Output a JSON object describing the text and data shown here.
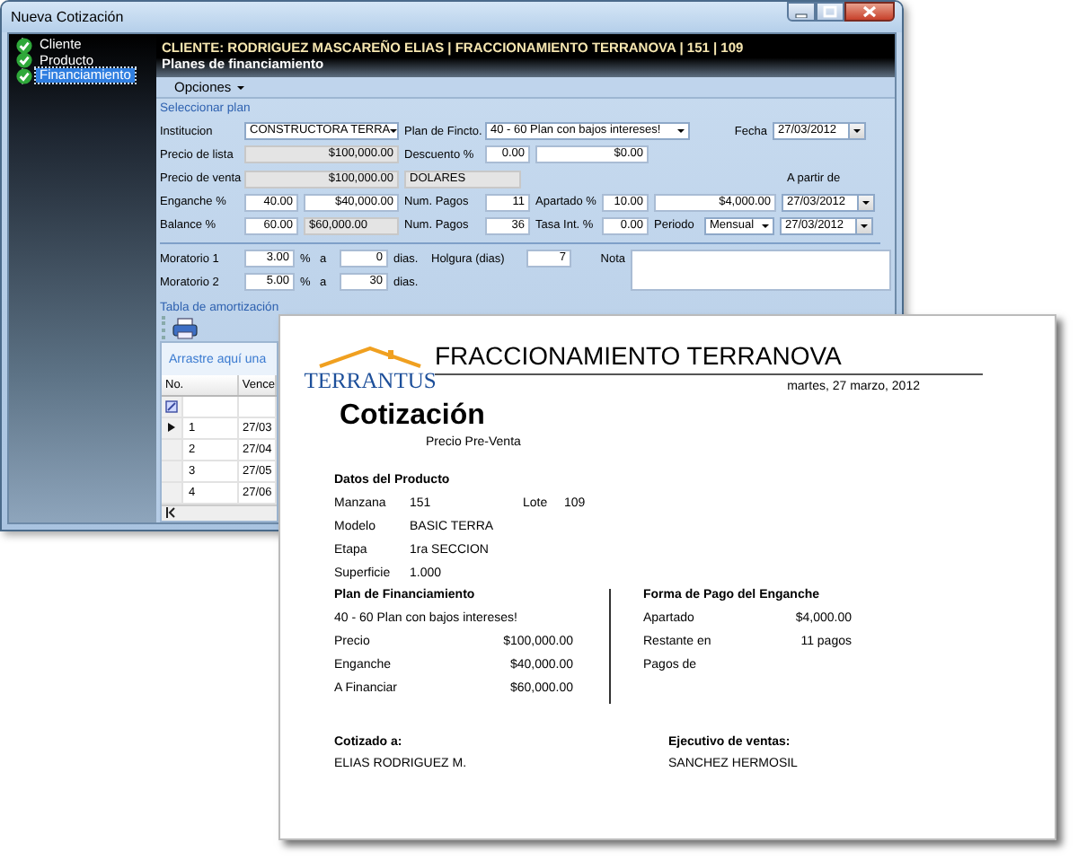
{
  "window": {
    "title": "Nueva Cotización"
  },
  "steps": [
    {
      "label": "Cliente",
      "checked": true,
      "selected": false
    },
    {
      "label": "Producto",
      "checked": true,
      "selected": false
    },
    {
      "label": "Financiamiento",
      "checked": true,
      "selected": true
    }
  ],
  "header": {
    "client": "CLIENTE: RODRIGUEZ MASCAREÑO ELIAS | FRACCIONAMIENTO TERRANOVA | 151 | 109",
    "section": "Planes de financiamiento"
  },
  "menu": [
    {
      "label": "Opciones"
    }
  ],
  "plan": {
    "title": "Seleccionar plan",
    "rows": [
      {
        "items": [
          {
            "kind": "label",
            "text": "Institucion"
          },
          {
            "kind": "combo",
            "value": "CONSTRUCTORA TERRA"
          },
          {
            "kind": "label",
            "text": "Plan de Fincto."
          },
          {
            "kind": "combo",
            "value": "40 - 60 Plan con bajos intereses!"
          },
          {
            "kind": "label",
            "text": "Fecha"
          },
          {
            "kind": "date",
            "value": "27/03/2012"
          }
        ]
      },
      {
        "items": [
          {
            "kind": "label",
            "text": "Precio de lista"
          },
          {
            "kind": "field",
            "value": "$100,000.00",
            "readonly": true
          },
          {
            "kind": "label",
            "text": "Descuento %"
          },
          {
            "kind": "field",
            "value": "0.00",
            "readonly": false
          },
          {
            "kind": "field",
            "value": "$0.00",
            "readonly": false
          }
        ]
      },
      {
        "items": [
          {
            "kind": "label",
            "text": "Precio de venta"
          },
          {
            "kind": "field",
            "value": "$100,000.00",
            "readonly": true
          },
          {
            "kind": "field",
            "value": "DOLARES",
            "readonly": true
          },
          {
            "kind": "label",
            "text": "A partir de"
          }
        ]
      },
      {
        "items": [
          {
            "kind": "label",
            "text": "Enganche %"
          },
          {
            "kind": "field",
            "value": "40.00",
            "readonly": false
          },
          {
            "kind": "field",
            "value": "$40,000.00",
            "readonly": false
          },
          {
            "kind": "label",
            "text": "Num. Pagos"
          },
          {
            "kind": "field",
            "value": "11",
            "readonly": false
          },
          {
            "kind": "label",
            "text": "Apartado %"
          },
          {
            "kind": "field",
            "value": "10.00",
            "readonly": false
          },
          {
            "kind": "field",
            "value": "$4,000.00",
            "readonly": false
          },
          {
            "kind": "date",
            "value": "27/03/2012"
          }
        ]
      },
      {
        "items": [
          {
            "kind": "label",
            "text": "Balance %"
          },
          {
            "kind": "field",
            "value": "60.00",
            "readonly": false
          },
          {
            "kind": "field",
            "value": "$60,000.00",
            "readonly": true
          },
          {
            "kind": "label",
            "text": "Num. Pagos"
          },
          {
            "kind": "field",
            "value": "36",
            "readonly": false
          },
          {
            "kind": "label",
            "text": "Tasa Int. %"
          },
          {
            "kind": "field",
            "value": "0.00",
            "readonly": false
          },
          {
            "kind": "label",
            "text": "Periodo"
          },
          {
            "kind": "combo",
            "value": "Mensual"
          },
          {
            "kind": "date",
            "value": "27/03/2012"
          }
        ]
      }
    ]
  },
  "moratorium": {
    "rows": [
      {
        "items": [
          {
            "kind": "label",
            "text": "Moratorio 1"
          },
          {
            "kind": "field",
            "value": "3.00",
            "readonly": false
          },
          {
            "kind": "label",
            "text": "%"
          },
          {
            "kind": "label",
            "text": "a"
          },
          {
            "kind": "field",
            "value": "0",
            "readonly": false
          },
          {
            "kind": "label",
            "text": "dias."
          },
          {
            "kind": "label",
            "text": "Holgura (dias)"
          },
          {
            "kind": "field",
            "value": "7",
            "readonly": false
          }
        ]
      },
      {
        "items": [
          {
            "kind": "label",
            "text": "Moratorio 2"
          },
          {
            "kind": "field",
            "value": "5.00",
            "readonly": false
          },
          {
            "kind": "label",
            "text": "%"
          },
          {
            "kind": "label",
            "text": "a"
          },
          {
            "kind": "field",
            "value": "30",
            "readonly": false
          },
          {
            "kind": "label",
            "text": "dias."
          }
        ]
      }
    ],
    "note": {
      "label": "Nota"
    }
  },
  "amortization": {
    "title": "Tabla de amortización",
    "group_hint": "Arrastre aquí una",
    "columns": [
      "No.",
      "Vence"
    ],
    "rows": [
      {
        "cells": [
          "1",
          "27/03"
        ],
        "selected": true
      },
      {
        "cells": [
          "2",
          "27/04"
        ],
        "selected": false
      },
      {
        "cells": [
          "3",
          "27/05"
        ],
        "selected": false
      },
      {
        "cells": [
          "4",
          "27/06"
        ],
        "selected": false
      }
    ]
  },
  "report": {
    "logo": "TERRANTUS",
    "title": "FRACCIONAMIENTO TERRANOVA",
    "date": "martes, 27 marzo, 2012",
    "heading": "Cotización",
    "subtitle": "Precio Pre-Venta",
    "product": {
      "title": "Datos del Producto",
      "rows": [
        [
          "Manzana",
          "151",
          "Lote",
          "109"
        ],
        [
          "Modelo",
          "BASIC TERRA"
        ],
        [
          "Etapa",
          "1ra SECCION"
        ],
        [
          "Superficie",
          "1.000"
        ]
      ]
    },
    "financing": {
      "title": "Plan de Financiamiento",
      "plan": "40 - 60 Plan con bajos intereses!",
      "rows": [
        [
          "Precio",
          "$100,000.00"
        ],
        [
          "Enganche",
          "$40,000.00"
        ],
        [
          "A Financiar",
          "$60,000.00"
        ]
      ]
    },
    "down_payment": {
      "title": "Forma de Pago del Enganche",
      "rows": [
        [
          "Apartado",
          "$4,000.00"
        ],
        [
          "Restante en",
          "11 pagos"
        ],
        [
          "Pagos de"
        ]
      ]
    },
    "signatures": [
      {
        "title": "Cotizado a:",
        "name": "ELIAS RODRIGUEZ M."
      },
      {
        "title": "Ejecutivo de ventas:",
        "name": "SANCHEZ HERMOSIL"
      }
    ]
  }
}
